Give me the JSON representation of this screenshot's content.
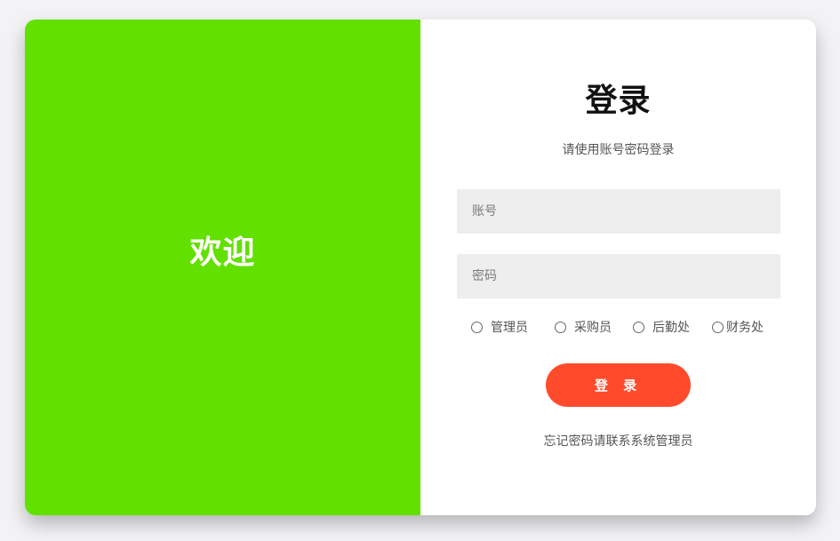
{
  "left": {
    "welcome_text": "欢迎"
  },
  "login": {
    "title": "登录",
    "subtitle": "请使用账号密码登录",
    "account_placeholder": "账号",
    "password_placeholder": "密码",
    "roles": [
      {
        "label": "管理员",
        "selected": false
      },
      {
        "label": "采购员",
        "selected": false
      },
      {
        "label": "后勤处",
        "selected": false
      },
      {
        "label": "财务处",
        "selected": false
      }
    ],
    "button_label": "登 录",
    "forgot_text": "忘记密码请联系系统管理员"
  },
  "colors": {
    "left_panel": "#62e000",
    "button": "#ff4b2b",
    "input_bg": "#eeeeee",
    "page_bg": "#f3f3f6"
  }
}
